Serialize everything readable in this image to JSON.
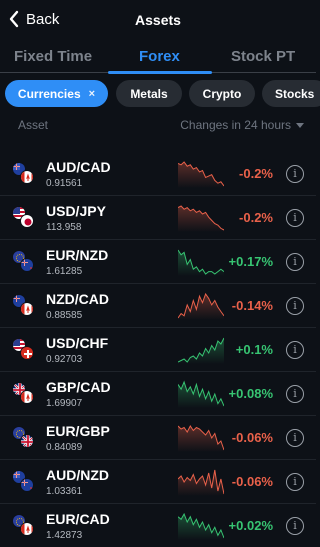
{
  "header": {
    "back_label": "Back",
    "title": "Assets"
  },
  "tabs": [
    {
      "label": "Fixed Time"
    },
    {
      "label": "Forex",
      "active": true
    },
    {
      "label": "Stock PT"
    }
  ],
  "chips": [
    {
      "label": "Currencies",
      "active": true,
      "close": "×"
    },
    {
      "label": "Metals"
    },
    {
      "label": "Crypto"
    },
    {
      "label": "Stocks"
    }
  ],
  "columns": {
    "asset": "Asset",
    "change": "Changes in 24 hours"
  },
  "colors": {
    "accent": "#2f8ef6",
    "negative": "#e9614a",
    "positive": "#37c472",
    "background": "#0d1117"
  },
  "assets": [
    {
      "symbol": "AUD/CAD",
      "price": "0.91561",
      "change": "-0.2%",
      "trend": "down",
      "flags": [
        "AU",
        "CA"
      ],
      "spark": [
        8,
        9,
        7,
        10,
        9,
        12,
        11,
        14,
        13,
        18,
        17,
        16,
        20,
        22,
        21,
        24
      ]
    },
    {
      "symbol": "USD/JPY",
      "price": "113.958",
      "change": "-0.2%",
      "trend": "down",
      "flags": [
        "US",
        "JP"
      ],
      "spark": [
        10,
        9,
        11,
        10,
        12,
        11,
        13,
        12,
        14,
        13,
        16,
        18,
        20,
        21,
        23,
        24
      ]
    },
    {
      "symbol": "EUR/NZD",
      "price": "1.61285",
      "change": "+0.17%",
      "trend": "up",
      "flags": [
        "EU",
        "NZ"
      ],
      "spark": [
        8,
        10,
        9,
        14,
        12,
        16,
        15,
        17,
        16,
        18,
        17,
        17,
        18,
        17,
        16,
        17
      ]
    },
    {
      "symbol": "NZD/CAD",
      "price": "0.88585",
      "change": "-0.14%",
      "trend": "down",
      "flags": [
        "NZ",
        "CA"
      ],
      "spark": [
        20,
        18,
        19,
        14,
        17,
        12,
        16,
        10,
        13,
        9,
        11,
        14,
        12,
        15,
        17,
        19
      ]
    },
    {
      "symbol": "USD/CHF",
      "price": "0.92703",
      "change": "+0.1%",
      "trend": "up",
      "flags": [
        "US",
        "CH"
      ],
      "spark": [
        22,
        21,
        20,
        22,
        19,
        18,
        20,
        16,
        18,
        13,
        16,
        11,
        14,
        8,
        10,
        6
      ]
    },
    {
      "symbol": "GBP/CAD",
      "price": "1.69907",
      "change": "+0.08%",
      "trend": "up",
      "flags": [
        "GB",
        "CA"
      ],
      "spark": [
        10,
        12,
        9,
        13,
        11,
        14,
        10,
        15,
        12,
        16,
        13,
        17,
        14,
        18,
        16,
        19
      ]
    },
    {
      "symbol": "EUR/GBP",
      "price": "0.84089",
      "change": "-0.06%",
      "trend": "down",
      "flags": [
        "EU",
        "GB"
      ],
      "spark": [
        8,
        10,
        9,
        12,
        8,
        11,
        9,
        10,
        12,
        14,
        11,
        16,
        13,
        20,
        18,
        24
      ]
    },
    {
      "symbol": "AUD/NZD",
      "price": "1.03361",
      "change": "-0.06%",
      "trend": "down",
      "flags": [
        "AU",
        "NZ"
      ],
      "spark": [
        12,
        10,
        14,
        11,
        13,
        9,
        15,
        12,
        10,
        16,
        8,
        18,
        6,
        20,
        12,
        22
      ]
    },
    {
      "symbol": "EUR/CAD",
      "price": "1.42873",
      "change": "+0.02%",
      "trend": "up",
      "flags": [
        "EU",
        "CA"
      ],
      "spark": [
        10,
        11,
        9,
        12,
        10,
        13,
        11,
        14,
        12,
        15,
        13,
        16,
        14,
        17,
        15,
        18
      ]
    }
  ]
}
